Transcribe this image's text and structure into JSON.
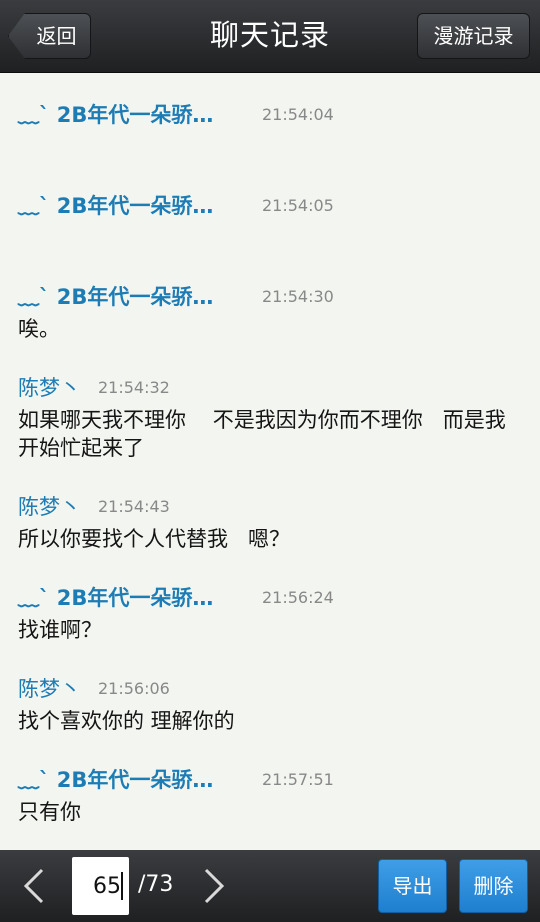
{
  "header": {
    "title": "聊天记录",
    "back_label": "返回",
    "roam_label": "漫游记录"
  },
  "messages": [
    {
      "sender": "﹏ˋ 2B年代一朵骄…",
      "time": "21:54:04",
      "text": ""
    },
    {
      "sender": "﹏ˋ 2B年代一朵骄…",
      "time": "21:54:05",
      "text": ""
    },
    {
      "sender": "﹏ˋ 2B年代一朵骄…",
      "time": "21:54:30",
      "text": "唉。"
    },
    {
      "sender": "陈梦丶",
      "time": "21:54:32",
      "text": "如果哪天我不理你    不是我因为你而不理你   而是我开始忙起来了"
    },
    {
      "sender": "陈梦丶",
      "time": "21:54:43",
      "text": "所以你要找个人代替我   嗯？"
    },
    {
      "sender": "﹏ˋ 2B年代一朵骄…",
      "time": "21:56:24",
      "text": "找谁啊？"
    },
    {
      "sender": "陈梦丶",
      "time": "21:56:06",
      "text": "找个喜欢你的 理解你的"
    },
    {
      "sender": "﹏ˋ 2B年代一朵骄…",
      "time": "21:57:51",
      "text": "只有你"
    }
  ],
  "footer": {
    "page_value": "65",
    "page_total": "/73",
    "export_label": "导出",
    "delete_label": "删除",
    "prev_icon": "chevron-left-icon",
    "next_icon": "chevron-right-icon"
  },
  "colors": {
    "bar": "#2b2c2e",
    "background": "#f3f6f0",
    "sender": "#1e7cb5",
    "accent_button": "#2d8fdc"
  }
}
